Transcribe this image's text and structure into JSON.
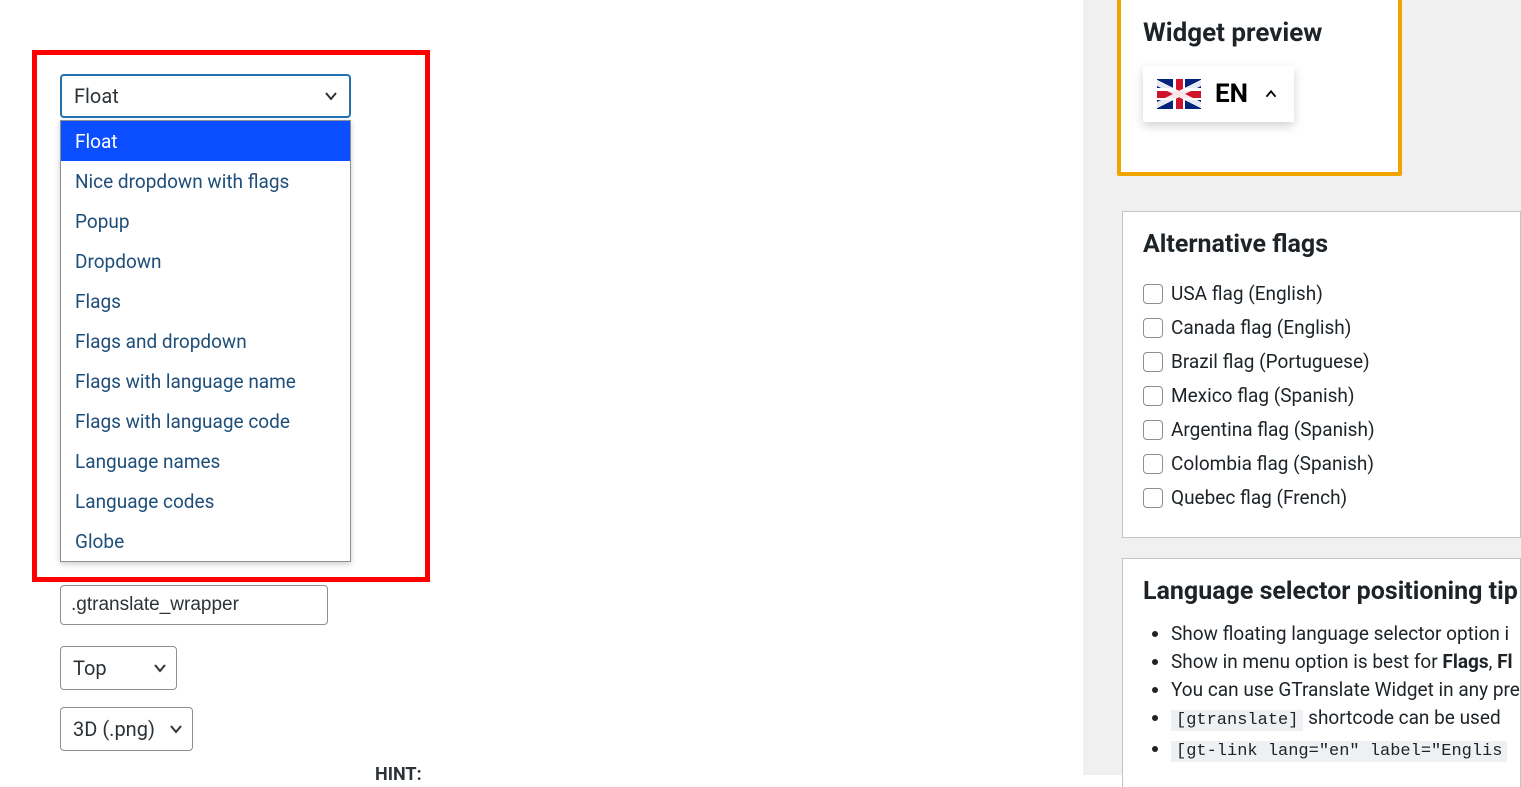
{
  "widget_look": {
    "selected": "Float",
    "options": [
      "Float",
      "Nice dropdown with flags",
      "Popup",
      "Dropdown",
      "Flags",
      "Flags and dropdown",
      "Flags with language name",
      "Flags with language code",
      "Language names",
      "Language codes",
      "Globe"
    ]
  },
  "wrapper_selector": ".gtranslate_wrapper",
  "position_select": "Top",
  "flag_style_select": "3D (.png)",
  "hint": {
    "label": "HINT:"
  },
  "preview": {
    "title": "Widget preview",
    "lang_code": "EN"
  },
  "alt_flags": {
    "title": "Alternative flags",
    "items": [
      "USA flag (English)",
      "Canada flag (English)",
      "Brazil flag (Portuguese)",
      "Mexico flag (Spanish)",
      "Argentina flag (Spanish)",
      "Colombia flag (Spanish)",
      "Quebec flag (French)"
    ]
  },
  "tips": {
    "title": "Language selector positioning tip",
    "items": [
      {
        "text_before": "Show floating language selector option i"
      },
      {
        "text_before": "Show in menu option is best for ",
        "bold1": "Flags",
        "sep": ", ",
        "bold2": "Fl"
      },
      {
        "text_before": "You can use GTranslate Widget in any pre"
      },
      {
        "code": "[gtranslate]",
        "text_after": " shortcode can be used"
      },
      {
        "code": "[gt-link lang=\"en\" label=\"Englis"
      }
    ]
  }
}
